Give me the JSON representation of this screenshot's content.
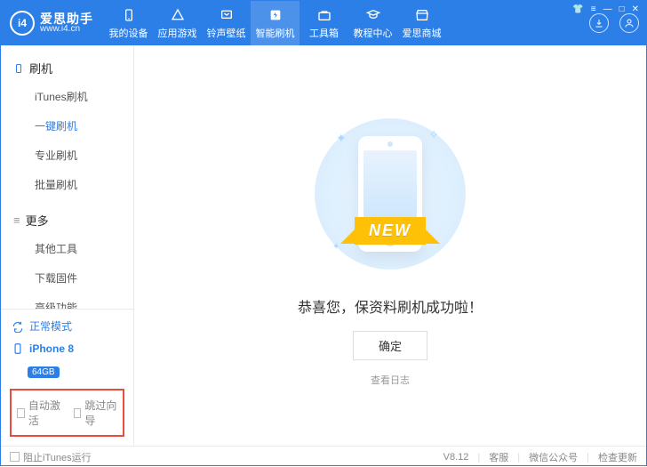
{
  "brand": {
    "title": "爱思助手",
    "subtitle": "www.i4.cn",
    "logo": "i4"
  },
  "nav": {
    "items": [
      {
        "label": "我的设备"
      },
      {
        "label": "应用游戏"
      },
      {
        "label": "铃声壁纸"
      },
      {
        "label": "智能刷机"
      },
      {
        "label": "工具箱"
      },
      {
        "label": "教程中心"
      },
      {
        "label": "爱思商城"
      }
    ],
    "activeIndex": 3
  },
  "sidebar": {
    "section1": {
      "title": "刷机"
    },
    "items1": [
      {
        "label": "iTunes刷机"
      },
      {
        "label": "一键刷机"
      },
      {
        "label": "专业刷机"
      },
      {
        "label": "批量刷机"
      }
    ],
    "activeIndex1": 1,
    "section2": {
      "title": "更多"
    },
    "items2": [
      {
        "label": "其他工具"
      },
      {
        "label": "下载固件"
      },
      {
        "label": "高级功能"
      }
    ],
    "mode": {
      "label": "正常模式"
    },
    "device": {
      "name": "iPhone 8",
      "badge": "64GB"
    },
    "options": {
      "autoActivate": "自动激活",
      "skipGuide": "跳过向导"
    }
  },
  "main": {
    "ribbon": "NEW",
    "success": "恭喜您，保资料刷机成功啦！",
    "ok": "确定",
    "log": "查看日志"
  },
  "footer": {
    "blockItunes": "阻止iTunes运行",
    "version": "V8.12",
    "support": "客服",
    "wechat": "微信公众号",
    "update": "检查更新"
  }
}
